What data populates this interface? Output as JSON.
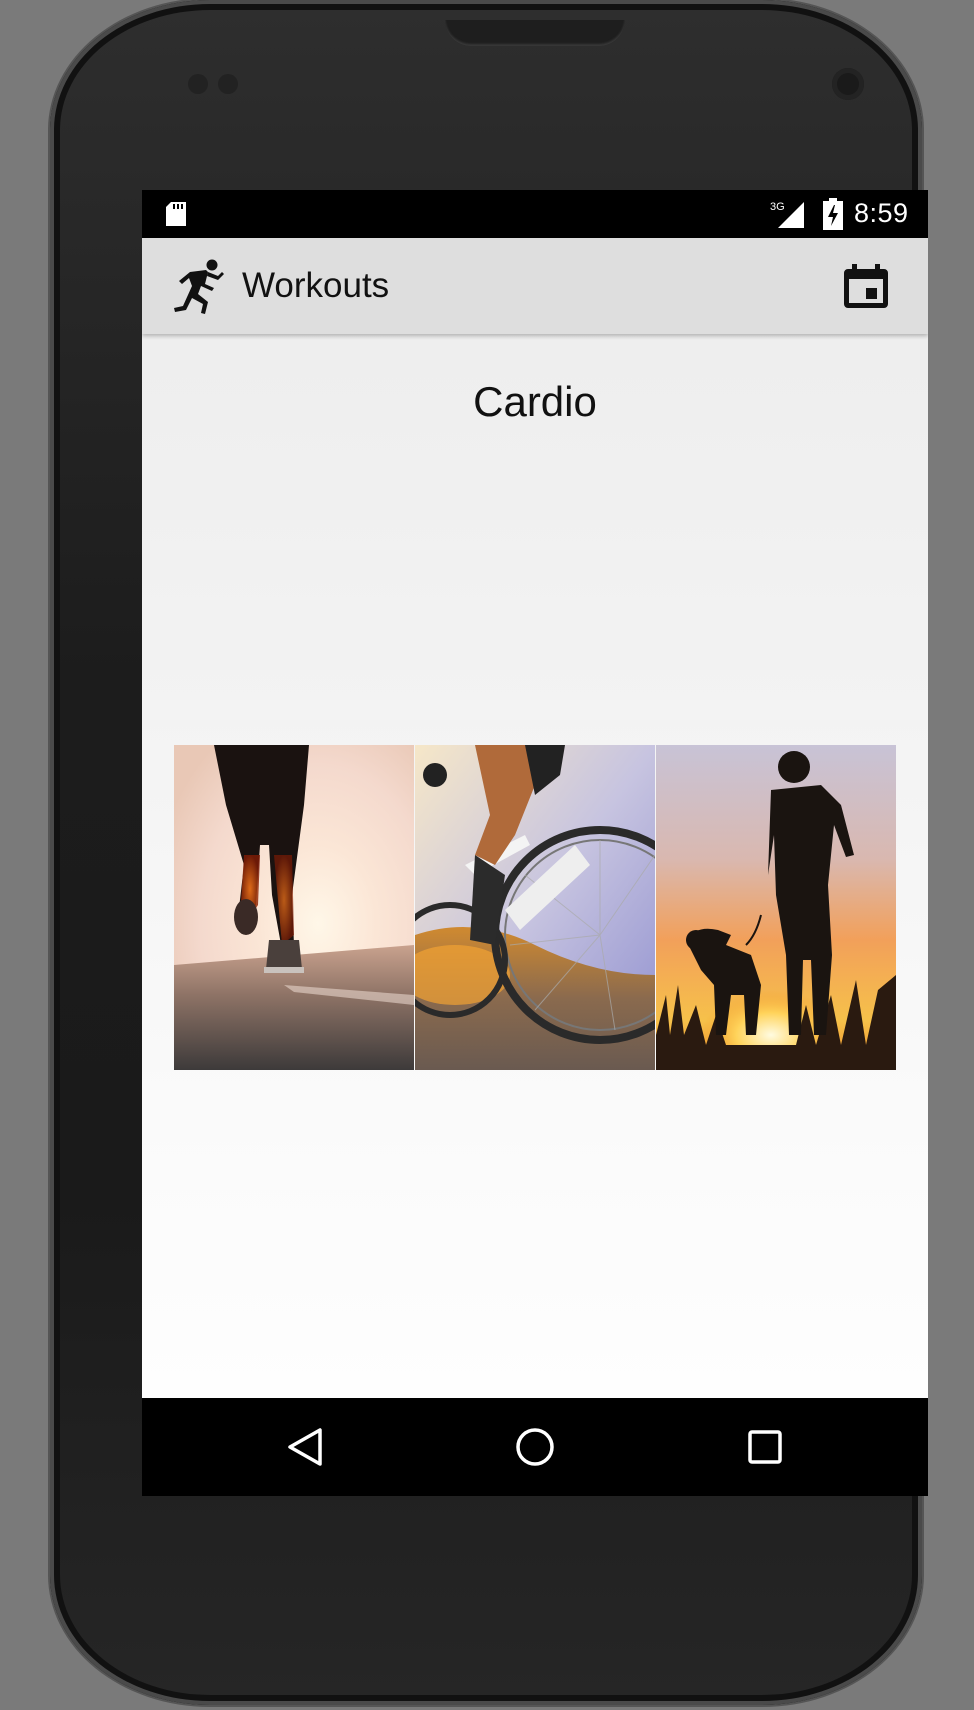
{
  "status_bar": {
    "time": "8:59",
    "network_label": "3G",
    "icons": [
      "sd-card-icon",
      "cell-signal-icon",
      "battery-charging-icon"
    ]
  },
  "app_bar": {
    "title": "Workouts",
    "logo_icon": "running-person-icon",
    "action_icon": "calendar-icon"
  },
  "main": {
    "section_title": "Cardio",
    "images": [
      "running-photo",
      "cycling-photo",
      "dog-walking-photo"
    ]
  },
  "nav_bar": {
    "buttons": [
      "back-icon",
      "home-icon",
      "recents-icon"
    ]
  },
  "colors": {
    "app_bar_bg": "#dedede",
    "status_bar_bg": "#000000",
    "screen_bg": "#f3f3f3",
    "sunset_orange": "#f08a24"
  }
}
